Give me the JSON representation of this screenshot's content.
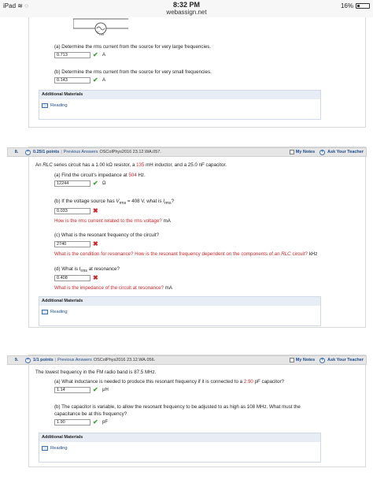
{
  "statusbar": {
    "device": "iPad",
    "time": "8:32 PM",
    "url": "webassign.net",
    "battery": "16%",
    "battery_fraction": 0.16
  },
  "q7": {
    "source_label": "V",
    "source_sub": "rms",
    "a_text": "(a) Determine the rms current from the source for very large frequencies.",
    "a_answer": "0.713",
    "a_unit": "A",
    "b_text": "(b) Determine the rms current from the source for very small frequencies.",
    "b_answer": "0.143",
    "b_unit": "A",
    "additional": "Additional Materials",
    "reading": "Reading"
  },
  "q8": {
    "number": "8.",
    "points": "0.25/1 points",
    "sep": "|",
    "previous": "Previous Answers",
    "ref": "OSColPhys2016 23.12.WA.057.",
    "my_notes": "My Notes",
    "ask_teacher": "Ask Your Teacher",
    "intro_1": "An ",
    "intro_rlc": "RLC",
    "intro_2": " series circuit has a 1.00 kΩ resistor, a ",
    "intro_135": "135",
    "intro_3": " mH inductor, and a 25.0 nF capacitor.",
    "a_text_1": "(a) Find the circuit's impedance at ",
    "a_freq": "504",
    "a_text_2": " Hz.",
    "a_answer": "12244",
    "a_unit": "Ω",
    "b_text_1": "(b) If the voltage source has ",
    "b_v": "V",
    "b_v_sub": "rms",
    "b_text_2": " = 408 V, what is ",
    "b_i": "I",
    "b_i_sub": "rms",
    "b_text_3": "?",
    "b_answer": "0.033",
    "b_hint": "How is the rms current related to the rms voltage?",
    "b_unit": "mA",
    "c_text": "(c) What is the resonant frequency of the circuit?",
    "c_answer": "2740",
    "c_hint_1": "What is the condition for resonance? How is the resonant frequency dependent on the components of an ",
    "c_hint_rlc": "RLC",
    "c_hint_2": " circuit?",
    "c_unit": "kHz",
    "d_text_1": "(d) What is ",
    "d_i": "I",
    "d_i_sub": "rms",
    "d_text_2": " at resonance?",
    "d_answer": "0.408",
    "d_hint": "What is the impedance of the circuit at resonance?",
    "d_unit": "mA",
    "additional": "Additional Materials",
    "reading": "Reading"
  },
  "q9": {
    "number": "9.",
    "points": "1/1 points",
    "sep": "|",
    "previous": "Previous Answers",
    "ref": "OSColPhys2016 23.12.WA.056.",
    "my_notes": "My Notes",
    "ask_teacher": "Ask Your Teacher",
    "intro": "The lowest frequency in the FM radio band is 87.5 MHz.",
    "a_text_1": "(a) What inductance is needed to produce this resonant frequency if it is connected to a ",
    "a_val": "2.90",
    "a_text_2": " pF capacitor?",
    "a_answer": "1.14",
    "a_unit": "μH",
    "b_text_line1": "(b) The capacitor is variable, to allow the resonant frequency to be adjusted to as high as 108 MHz. What must the",
    "b_text_line2": "capacitance be at this frequency?",
    "b_answer": "1.90",
    "b_unit": "pF",
    "additional": "Additional Materials",
    "reading": "Reading"
  },
  "colors": {
    "red": "#d0262a",
    "green": "#3aa33a",
    "blue": "#1a4b8c"
  },
  "icons": {
    "correct": "check-icon",
    "incorrect": "x-icon"
  }
}
